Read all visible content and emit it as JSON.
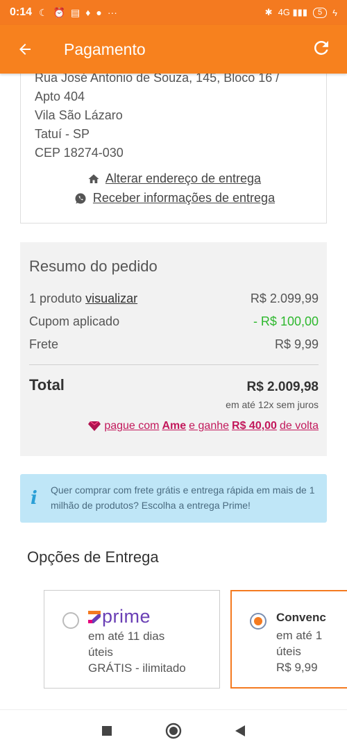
{
  "status_bar": {
    "time": "0:14",
    "signal_label": "4G",
    "battery": "5"
  },
  "appbar": {
    "title": "Pagamento",
    "back_icon": "arrow-left-icon",
    "refresh_icon": "refresh-icon"
  },
  "address": {
    "lines": [
      "Rua José Antonio de Souza, 145, Bloco 16 /",
      "Apto 404",
      "Vila São Lázaro",
      "Tatuí - SP",
      "CEP 18274-030"
    ],
    "change_link": "Alterar endereço de entrega",
    "info_link": "Receber informações de entrega"
  },
  "summary": {
    "title": "Resumo do pedido",
    "products_label": "1 produto",
    "products_link": "visualizar",
    "products_value": "R$ 2.099,99",
    "coupon_label": "Cupom aplicado",
    "coupon_value": "- R$ 100,00",
    "shipping_label": "Frete",
    "shipping_value": "R$ 9,99",
    "total_label": "Total",
    "total_value": "R$ 2.009,98",
    "installments": "em até 12x sem juros",
    "ame_pre": "pague com",
    "ame_brand": "Ame",
    "ame_mid": "e ganhe",
    "ame_amount": "R$ 40,00",
    "ame_post": "de volta"
  },
  "info_banner": {
    "icon": "i",
    "text": "Quer comprar com frete grátis e entrega rápida em mais de 1 milhão de produtos? Escolha a entrega Prime!"
  },
  "delivery": {
    "title": "Opções de Entrega",
    "options": [
      {
        "brand": "prime",
        "line1": "em até 11 dias",
        "line2": "úteis",
        "line3": "GRÁTIS - ilimitado",
        "selected": false
      },
      {
        "name": "Convenc",
        "line1": "em até 1",
        "line2": "úteis",
        "line3": "R$ 9,99",
        "selected": true
      }
    ]
  },
  "colors": {
    "brand_orange": "#f47a20",
    "coupon_green": "#2eb82e",
    "ame_pink": "#c2185b",
    "info_bg": "#bfe6f7",
    "prime_purple": "#6a3fb5"
  }
}
